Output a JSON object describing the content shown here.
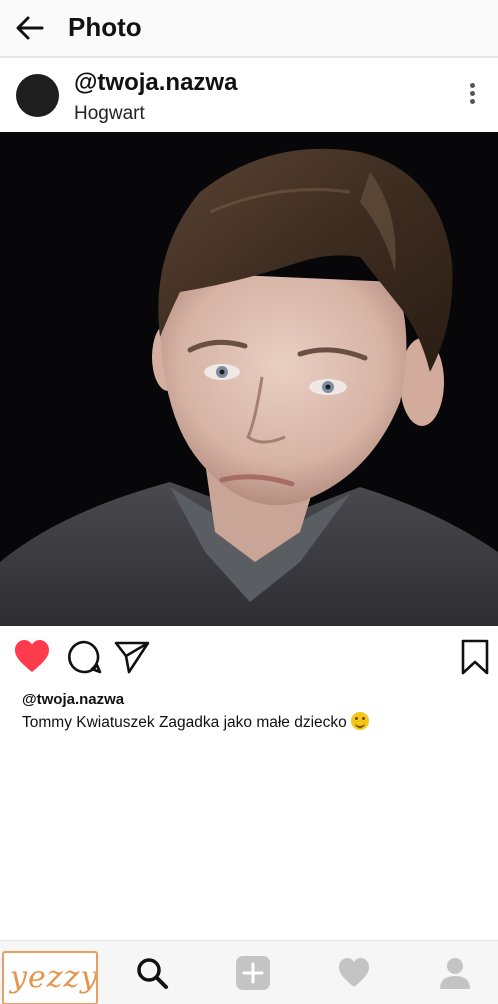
{
  "header": {
    "title": "Photo"
  },
  "post": {
    "username": "@twoja.nazwa",
    "location": "Hogwart",
    "caption_user": "@twoja.nazwa",
    "caption_text": "Tommy Kwiatuszek Zagadka jako małe dziecko",
    "liked": true
  },
  "bottom_nav": {
    "logo_text": "yezzy",
    "items": [
      "search-icon",
      "add-icon",
      "heart-icon",
      "profile-icon"
    ]
  },
  "colors": {
    "like_red": "#ff3b4e",
    "logo_orange": "#e4954e",
    "icon_dark": "#111111",
    "icon_gray": "#c4c4c4"
  }
}
